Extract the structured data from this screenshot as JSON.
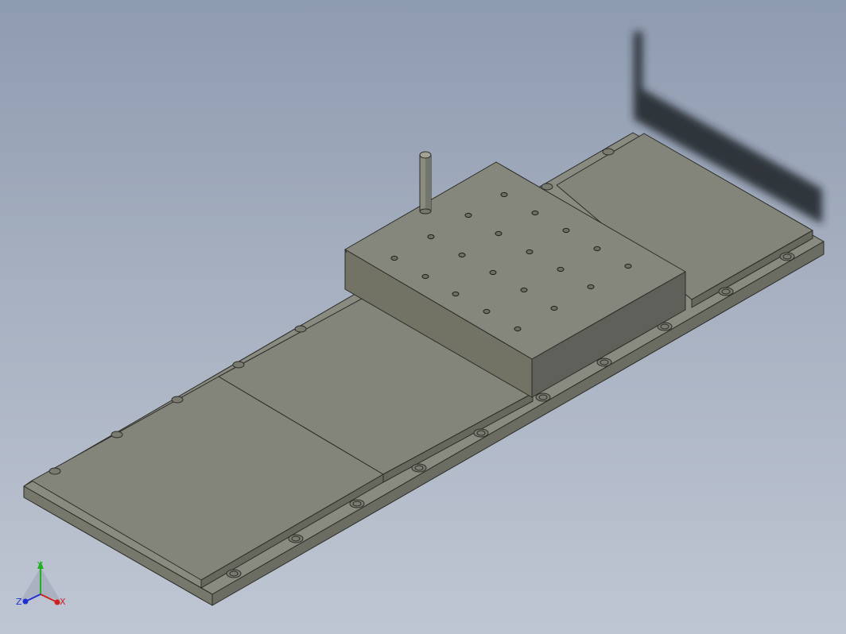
{
  "viewport": {
    "background_top": "#8e9bb0",
    "background_bottom": "#bfc6d3"
  },
  "colors": {
    "part_top": "#84857a",
    "part_side_left": "#707063",
    "part_side_right": "#5e5f57",
    "edge": "#2c2c28",
    "shadow": "#1e2228"
  },
  "triad": {
    "x_label": "X",
    "y_label": "Y",
    "z_label": "Z",
    "x_color": "#d02020",
    "y_color": "#20b020",
    "z_color": "#2030d0"
  }
}
